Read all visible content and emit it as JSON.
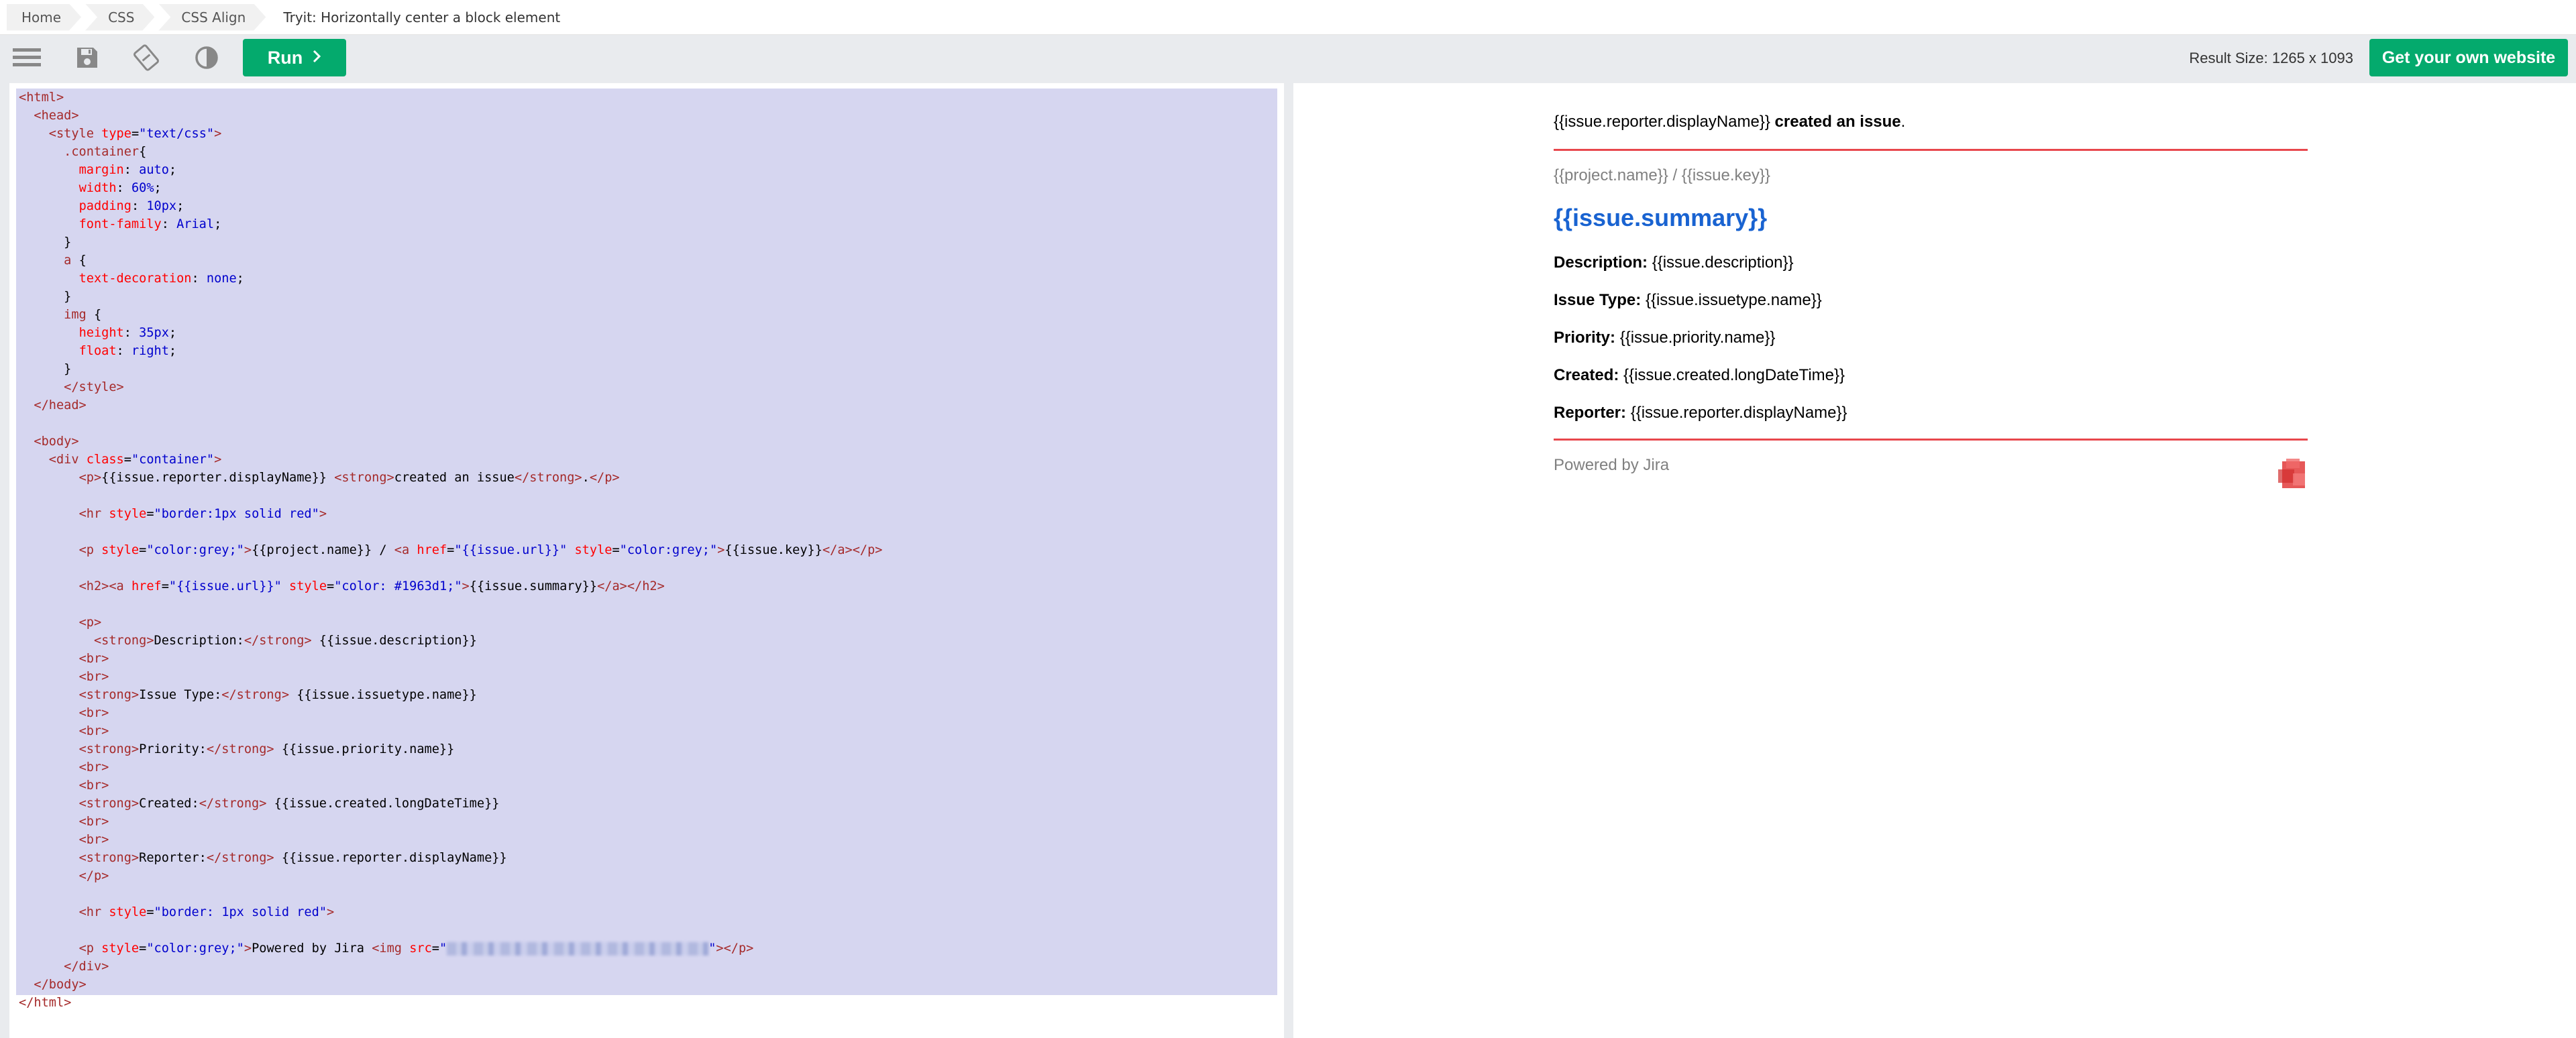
{
  "breadcrumb": {
    "items": [
      "Home",
      "CSS",
      "CSS Align"
    ],
    "current": "Tryit: Horizontally center a block element"
  },
  "toolbar": {
    "icons": [
      "menu-icon",
      "save-icon",
      "rotate-icon",
      "contrast-icon"
    ],
    "run_label": "Run",
    "result_size": "Result Size: 1265 x 1093",
    "own_website_label": "Get your own website"
  },
  "result": {
    "reporter_text": "{{issue.reporter.displayName}}",
    "created_text": "created an issue",
    "period": ".",
    "project_key": "{{project.name}} / {{issue.key}}",
    "summary": "{{issue.summary}}",
    "fields": [
      {
        "label": "Description:",
        "value": "{{issue.description}}"
      },
      {
        "label": "Issue Type:",
        "value": "{{issue.issuetype.name}}"
      },
      {
        "label": "Priority:",
        "value": "{{issue.priority.name}}"
      },
      {
        "label": "Created:",
        "value": "{{issue.created.longDateTime}}"
      },
      {
        "label": "Reporter:",
        "value": "{{issue.reporter.displayName}}"
      }
    ],
    "powered_by": "Powered by Jira"
  },
  "colors": {
    "accent_green": "#04aa6d",
    "selection": "#d6d6f0",
    "summary_link": "#1963d1",
    "hr_red": "#e8474c"
  }
}
